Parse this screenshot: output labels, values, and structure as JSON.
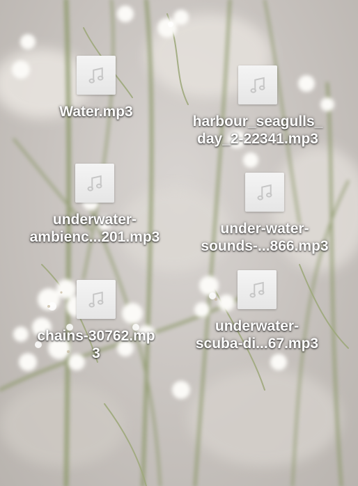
{
  "desktop": {
    "files": [
      {
        "name": "Water.mp3",
        "icon": "music-note-icon"
      },
      {
        "name": "harbour_seagulls_\nday_2-22341.mp3",
        "icon": "music-note-icon"
      },
      {
        "name": "underwater-\nambienc...201.mp3",
        "icon": "music-note-icon"
      },
      {
        "name": "under-water-\nsounds-...866.mp3",
        "icon": "music-note-icon"
      },
      {
        "name": "chains-30762.mp\n3",
        "icon": "music-note-icon"
      },
      {
        "name": "underwater-\nscuba-di...67.mp3",
        "icon": "music-note-icon"
      }
    ]
  }
}
